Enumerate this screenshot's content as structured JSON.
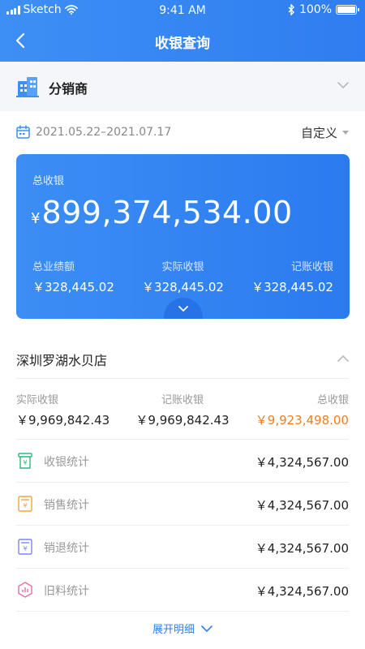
{
  "status": {
    "carrier": "Sketch",
    "time": "9:41 AM",
    "battery": "100%"
  },
  "nav": {
    "title": "收银查询"
  },
  "distributor": {
    "label": "分销商"
  },
  "date": {
    "range": "2021.05.22–2021.07.17",
    "custom": "自定义"
  },
  "summary": {
    "total_label": "总收银",
    "currency": "¥",
    "total_value": "899,374,534.00",
    "stats": [
      {
        "label": "总业绩额",
        "value": "￥328,445.02"
      },
      {
        "label": "实际收银",
        "value": "￥328,445.02"
      },
      {
        "label": "记账收银",
        "value": "￥328,445.02"
      }
    ]
  },
  "store": {
    "name": "深圳罗湖水贝店",
    "stats": [
      {
        "label": "实际收银",
        "value": "￥9,969,842.43"
      },
      {
        "label": "记账收银",
        "value": "￥9,969,842.43"
      },
      {
        "label": "总收银",
        "value": "￥9,923,498.00"
      }
    ],
    "rows": [
      {
        "label": "收银统计",
        "value": "￥4,324,567.00"
      },
      {
        "label": "销售统计",
        "value": "￥4,324,567.00"
      },
      {
        "label": "销退统计",
        "value": "￥4,324,567.00"
      },
      {
        "label": "旧料统计",
        "value": "￥4,324,567.00"
      }
    ],
    "expand_label": "展开明细"
  },
  "colors": {
    "primary": "#2f7df0",
    "orange": "#f07d22",
    "green": "#2db87c",
    "yellow": "#f2a33a",
    "purple": "#7b86f0",
    "pink": "#ef6aa0"
  }
}
